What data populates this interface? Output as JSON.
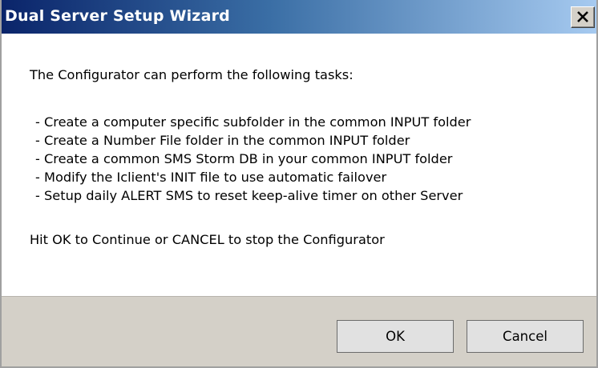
{
  "window": {
    "title": "Dual Server Setup Wizard",
    "close_icon": "close-icon"
  },
  "message": {
    "intro": "The Configurator can perform the following tasks:",
    "tasks": [
      "- Create a computer specific subfolder in the common INPUT folder",
      "- Create a Number File folder in the common INPUT folder",
      "- Create a common SMS Storm DB in your common INPUT folder",
      "- Modify the Iclient's INIT file to use automatic failover",
      "- Setup daily ALERT SMS to reset keep-alive timer on other Server"
    ],
    "footer_text": "Hit OK to Continue or CANCEL to stop the Configurator"
  },
  "buttons": {
    "ok_label": "OK",
    "cancel_label": "Cancel"
  },
  "colors": {
    "titlebar_start": "#0a246a",
    "titlebar_end": "#a6caf0",
    "footer_bg": "#d4d0c8"
  }
}
